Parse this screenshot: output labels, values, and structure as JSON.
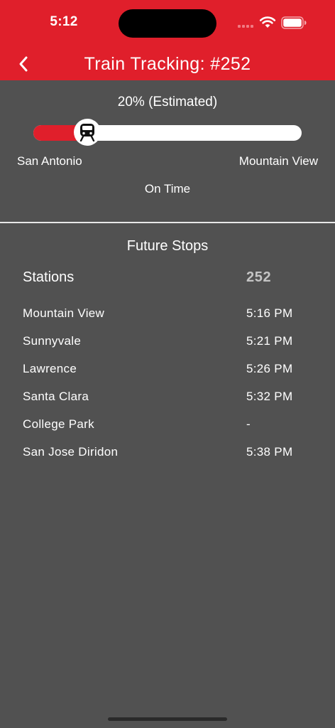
{
  "status_bar": {
    "time": "5:12"
  },
  "header": {
    "title": "Train Tracking: #252",
    "back_icon": "chevron-left-icon"
  },
  "progress": {
    "label": "20% (Estimated)",
    "fraction": 0.2,
    "origin": "San Antonio",
    "destination": "Mountain View",
    "status": "On Time",
    "train_icon": "train-icon"
  },
  "colors": {
    "accent": "#e01f2b",
    "background": "#515151",
    "track": "#ffffff"
  },
  "future_stops": {
    "title": "Future Stops",
    "col_stations": "Stations",
    "col_train": "252",
    "rows": [
      {
        "station": "Mountain View",
        "time": "5:16 PM"
      },
      {
        "station": "Sunnyvale",
        "time": "5:21 PM"
      },
      {
        "station": "Lawrence",
        "time": "5:26 PM"
      },
      {
        "station": "Santa Clara",
        "time": "5:32 PM"
      },
      {
        "station": "College Park",
        "time": "-"
      },
      {
        "station": "San Jose Diridon",
        "time": "5:38 PM"
      }
    ]
  }
}
